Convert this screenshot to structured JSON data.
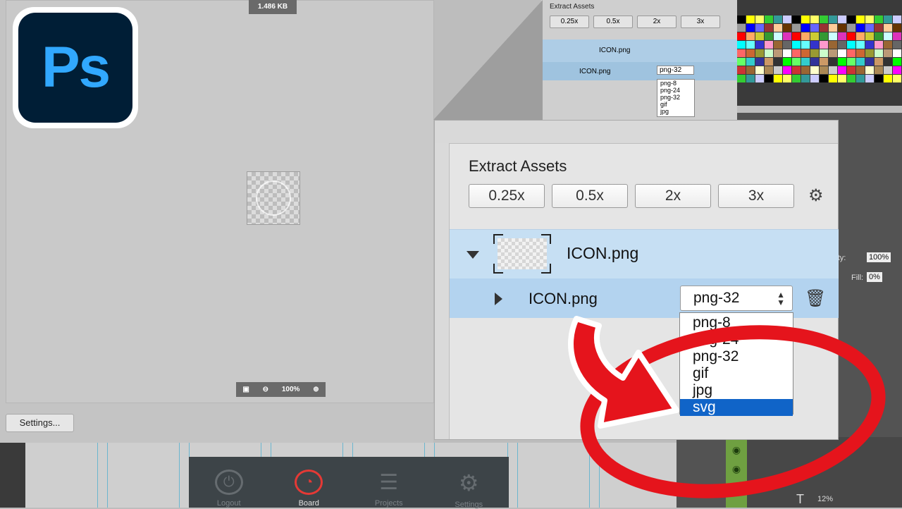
{
  "logo": {
    "text": "Ps"
  },
  "canvas": {
    "file_size": "1.486 KB",
    "zoom": "100%",
    "settings_button": "Settings..."
  },
  "bottom_toolbar": {
    "items": [
      {
        "label": "Logout",
        "icon": "power-icon"
      },
      {
        "label": "Board",
        "icon": "dial-icon",
        "active": true
      },
      {
        "label": "Projects",
        "icon": "menu-icon"
      },
      {
        "label": "Settings",
        "icon": "gear-icon"
      }
    ]
  },
  "background_panel": {
    "title": "Extract Assets",
    "scales": [
      "0.25x",
      "0.5x",
      "2x",
      "3x"
    ],
    "asset_name": "ICON.png",
    "sub_name": "ICON.png",
    "format": "png-32",
    "options": [
      "png-8",
      "png-24",
      "png-32",
      "gif",
      "jpg"
    ]
  },
  "extract_panel": {
    "title": "Extract Assets",
    "scales": [
      "0.25x",
      "0.5x",
      "2x",
      "3x"
    ],
    "asset": {
      "name": "ICON.png"
    },
    "sub_asset": {
      "name": "ICON.png",
      "format": "png-32"
    },
    "format_options": [
      "png-8",
      "png-24",
      "png-32",
      "gif",
      "jpg",
      "svg"
    ],
    "selected_option": "svg"
  },
  "right_panel": {
    "opacity_label": "Opacity:",
    "opacity_value": "100%",
    "fill_label": "Fill:",
    "fill_value": "0%",
    "layer_value": "12%"
  },
  "colors": {
    "ps_blue": "#31a8ff",
    "ps_dark": "#001e36",
    "selection_blue": "#1064c8",
    "annotation_red": "#e5141c"
  }
}
